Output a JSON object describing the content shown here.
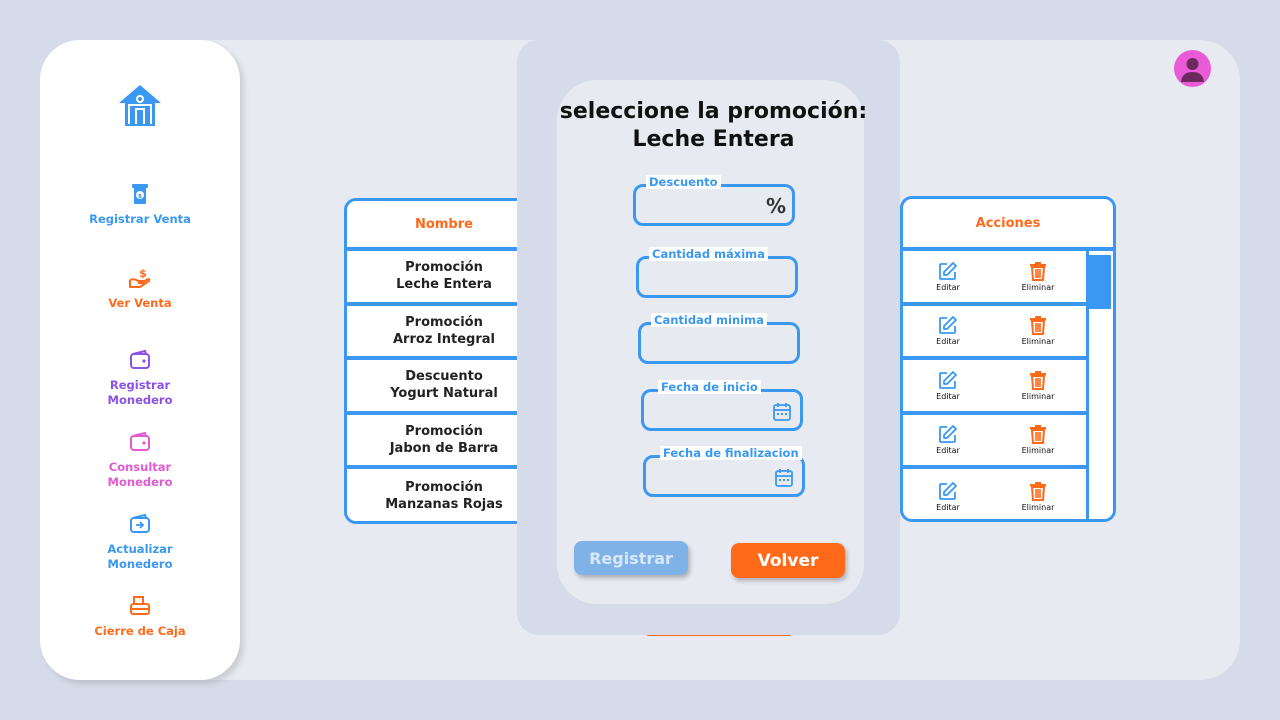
{
  "colors": {
    "accent_blue": "#3a98f2",
    "accent_orange": "#ff6a1a",
    "purple": "#8a52e6",
    "pink": "#e25ad2",
    "avatar": "#ea5ad6"
  },
  "sidebar": {
    "items": [
      {
        "label": "Registrar Venta",
        "icon": "cash-register-icon",
        "color": "#3a98f2"
      },
      {
        "label": "Ver Venta",
        "icon": "hand-dollar-icon",
        "color": "#ff6a1a"
      },
      {
        "label": "Registrar\nMonedero",
        "icon": "wallet-icon",
        "color": "#8a52e6"
      },
      {
        "label": "Consultar\nMonedero",
        "icon": "wallet-icon",
        "color": "#e25ad2"
      },
      {
        "label": "Actualizar\nMonedero",
        "icon": "wallet-arrow-icon",
        "color": "#3a98f2"
      },
      {
        "label": "Cierre de Caja",
        "icon": "cash-drawer-icon",
        "color": "#ff6a1a"
      }
    ]
  },
  "table_left": {
    "header": "Nombre",
    "rows": [
      [
        "Promoción",
        "Leche Entera"
      ],
      [
        "Promoción",
        "Arroz Integral"
      ],
      [
        "Descuento",
        "Yogurt Natural"
      ],
      [
        "Promoción",
        "Jabon de Barra"
      ],
      [
        "Promoción",
        "Manzanas Rojas"
      ]
    ]
  },
  "table_right": {
    "header": "Acciones",
    "edit_label": "Editar",
    "delete_label": "Eliminar"
  },
  "modal": {
    "title_line1": "seleccione la promoción:",
    "title_line2": "Leche Entera",
    "fields": {
      "descuento": {
        "label": "Descuento",
        "suffix": "%"
      },
      "cantidad_max": {
        "label": "Cantidad máxima"
      },
      "cantidad_min": {
        "label": "Cantidad minima"
      },
      "fecha_inicio": {
        "label": "Fecha de inicio"
      },
      "fecha_fin": {
        "label": "Fecha de finalizacion"
      }
    },
    "register_button": "Registrar",
    "back_button": "Volver"
  }
}
